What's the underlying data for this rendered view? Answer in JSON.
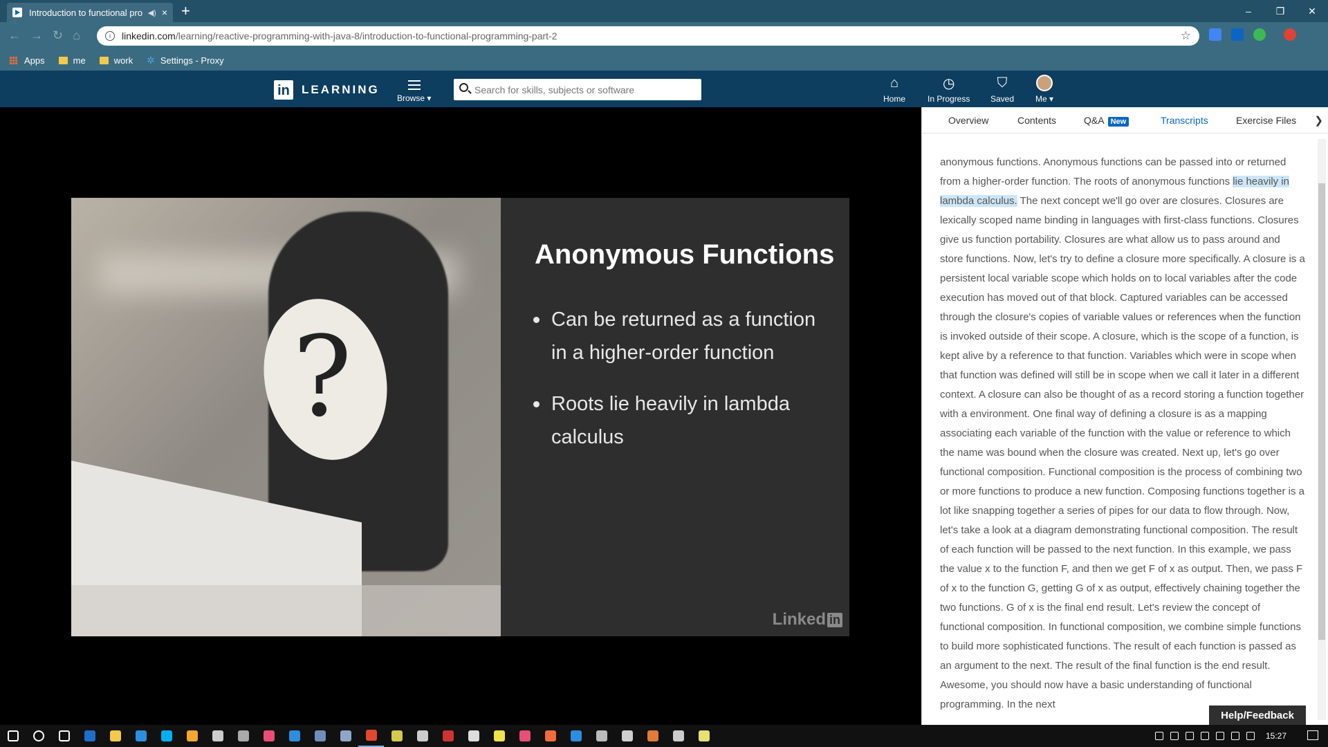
{
  "browser": {
    "tab_title": "Introduction to functional programming",
    "mute_icon": "speaker-icon",
    "close_tab": "×",
    "new_tab": "+",
    "window_buttons": [
      "–",
      "❐",
      "✕"
    ],
    "url_host": "linkedin.com",
    "url_path": "/learning/reactive-programming-with-java-8/introduction-to-functional-programming-part-2",
    "bookmarks": [
      "Apps",
      "me",
      "work",
      "Settings - Proxy"
    ]
  },
  "nav": {
    "brand_letters": "in",
    "brand_word": "LEARNING",
    "browse_label": "Browse ▾",
    "search_placeholder": "Search for skills, subjects or software",
    "home_label": "Home",
    "in_progress_label": "In Progress",
    "saved_label": "Saved",
    "me_label": "Me ▾"
  },
  "slide": {
    "title": "Anonymous Functions",
    "bullets": [
      "Can be returned as a function in a higher-order function",
      "Roots lie heavily in lambda calculus"
    ],
    "watermark_text": "Linked",
    "watermark_in": "in"
  },
  "panel": {
    "tabs": [
      "Overview",
      "Contents",
      "Q&A",
      "Transcripts",
      "Exercise Files"
    ],
    "new_badge": "New",
    "active_tab": "Transcripts",
    "transcript_before": "anonymous functions. Anonymous functions can be passed into or returned from a higher-order function. The roots of anonymous functions ",
    "transcript_highlight": "lie heavily in lambda calculus.",
    "transcript_after": " The next concept we'll go over are closures. Closures are lexically scoped name binding in languages with first-class functions. Closures give us function portability. Closures are what allow us to pass around and store functions. Now, let's try to define a closure more specifically. A closure is a persistent local variable scope which holds on to local variables after the code execution has moved out of that block. Captured variables can be accessed through the closure's copies of variable values or references when the function is invoked outside of their scope. A closure, which is the scope of a function, is kept alive by a reference to that function. Variables which were in scope when that function was defined will still be in scope when we call it later in a different context. A closure can also be thought of as a record storing a function together with a environment. One final way of defining a closure is as a mapping associating each variable of the function with the value or reference to which the name was bound when the closure was created. Next up, let's go over functional composition. Functional composition is the process of combining two or more functions to produce a new function. Composing functions together is a lot like snapping together a series of pipes for our data to flow through. Now, let's take a look at a diagram demonstrating functional composition. The result of each function will be passed to the next function. In this example, we pass the value x to the function F, and then we get F of x as output. Then, we pass F of x to the function G, getting G of x as output, effectively chaining together the two functions. G of x is the final end result. Let's review the concept of functional composition. In functional composition, we combine simple functions to build more sophisticated functions. The result of each function is passed as an argument to the next. The result of the final function is the end result. Awesome, you should now have a basic understanding of functional programming. In the next",
    "help_label": "Help/Feedback"
  },
  "taskbar": {
    "clock": "15:27",
    "icons": [
      "start-icon",
      "search-icon",
      "task-view-icon",
      "outlook-icon",
      "explorer-icon",
      "ie-icon",
      "skype-icon",
      "git-icon",
      "cmd-icon",
      "app-icon",
      "intellij-icon",
      "info-icon",
      "vbox-icon",
      "security-icon",
      "chrome-icon",
      "pen-icon",
      "network-icon",
      "screen-icon",
      "paint-icon",
      "sticky-icon",
      "intellij2-icon",
      "postman-icon",
      "vscode-icon",
      "app2-icon",
      "app3-icon",
      "app4-icon",
      "cmd2-icon",
      "notepad-icon"
    ],
    "icon_colors": [
      "#ffffff",
      "#ffffff",
      "#ffffff",
      "#1d6fc9",
      "#f2c94c",
      "#2d8ee0",
      "#00aff0",
      "#f0a830",
      "#cccccc",
      "#aaaaaa",
      "#e94e77",
      "#2d8ee0",
      "#6f8fb8",
      "#8fa6c8",
      "#e0482f",
      "#d4c94c",
      "#cccccc",
      "#cc3333",
      "#dddddd",
      "#f2e24c",
      "#e94e77",
      "#f26b3a",
      "#2d8ee0",
      "#bbbbbb",
      "#d0d0d0",
      "#e07b39",
      "#cccccc",
      "#e8e070"
    ]
  }
}
